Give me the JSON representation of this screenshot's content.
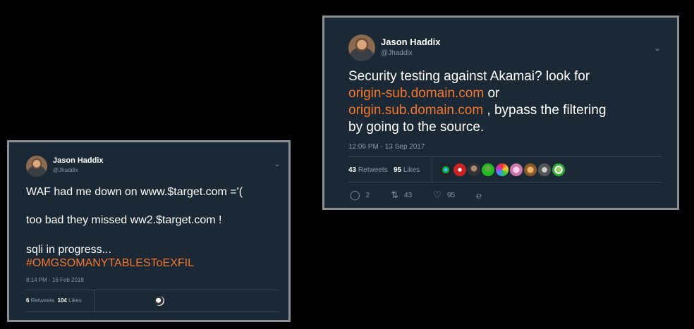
{
  "tweets": {
    "left": {
      "author_name": "Jason Haddix",
      "author_handle": "@Jhaddix",
      "lines": [
        "WAF had me down on www.$target.com ='(",
        "too bad they missed ww2.$target.com !",
        "sqli in progress...",
        "#OMGSOMANYTABLESToEXFIL"
      ],
      "timestamp": "8:14 PM - 16 Feb 2018",
      "retweets_count": "6",
      "retweets_label": "Retweets",
      "likes_count": "104",
      "likes_label": "Likes"
    },
    "right": {
      "author_name": "Jason Haddix",
      "author_handle": "@Jhaddix",
      "text_1": "Security testing against Akamai? look for",
      "link_1": "origin-sub.domain.com",
      "text_2": " or",
      "link_2": "origin.sub.domain.com",
      "text_3": " , bypass the filtering",
      "text_4": "by going to the source.",
      "timestamp": "12:06 PM - 13 Sep 2017",
      "retweets_count": "43",
      "retweets_label": "Retweets",
      "likes_count": "95",
      "likes_label": "Likes",
      "actions": {
        "reply_count": "2",
        "retweet_count": "43",
        "like_count": "95"
      }
    }
  },
  "colors": {
    "background": "#000000",
    "card": "#1b2836",
    "link": "#f4772f",
    "muted": "#8899a6"
  }
}
